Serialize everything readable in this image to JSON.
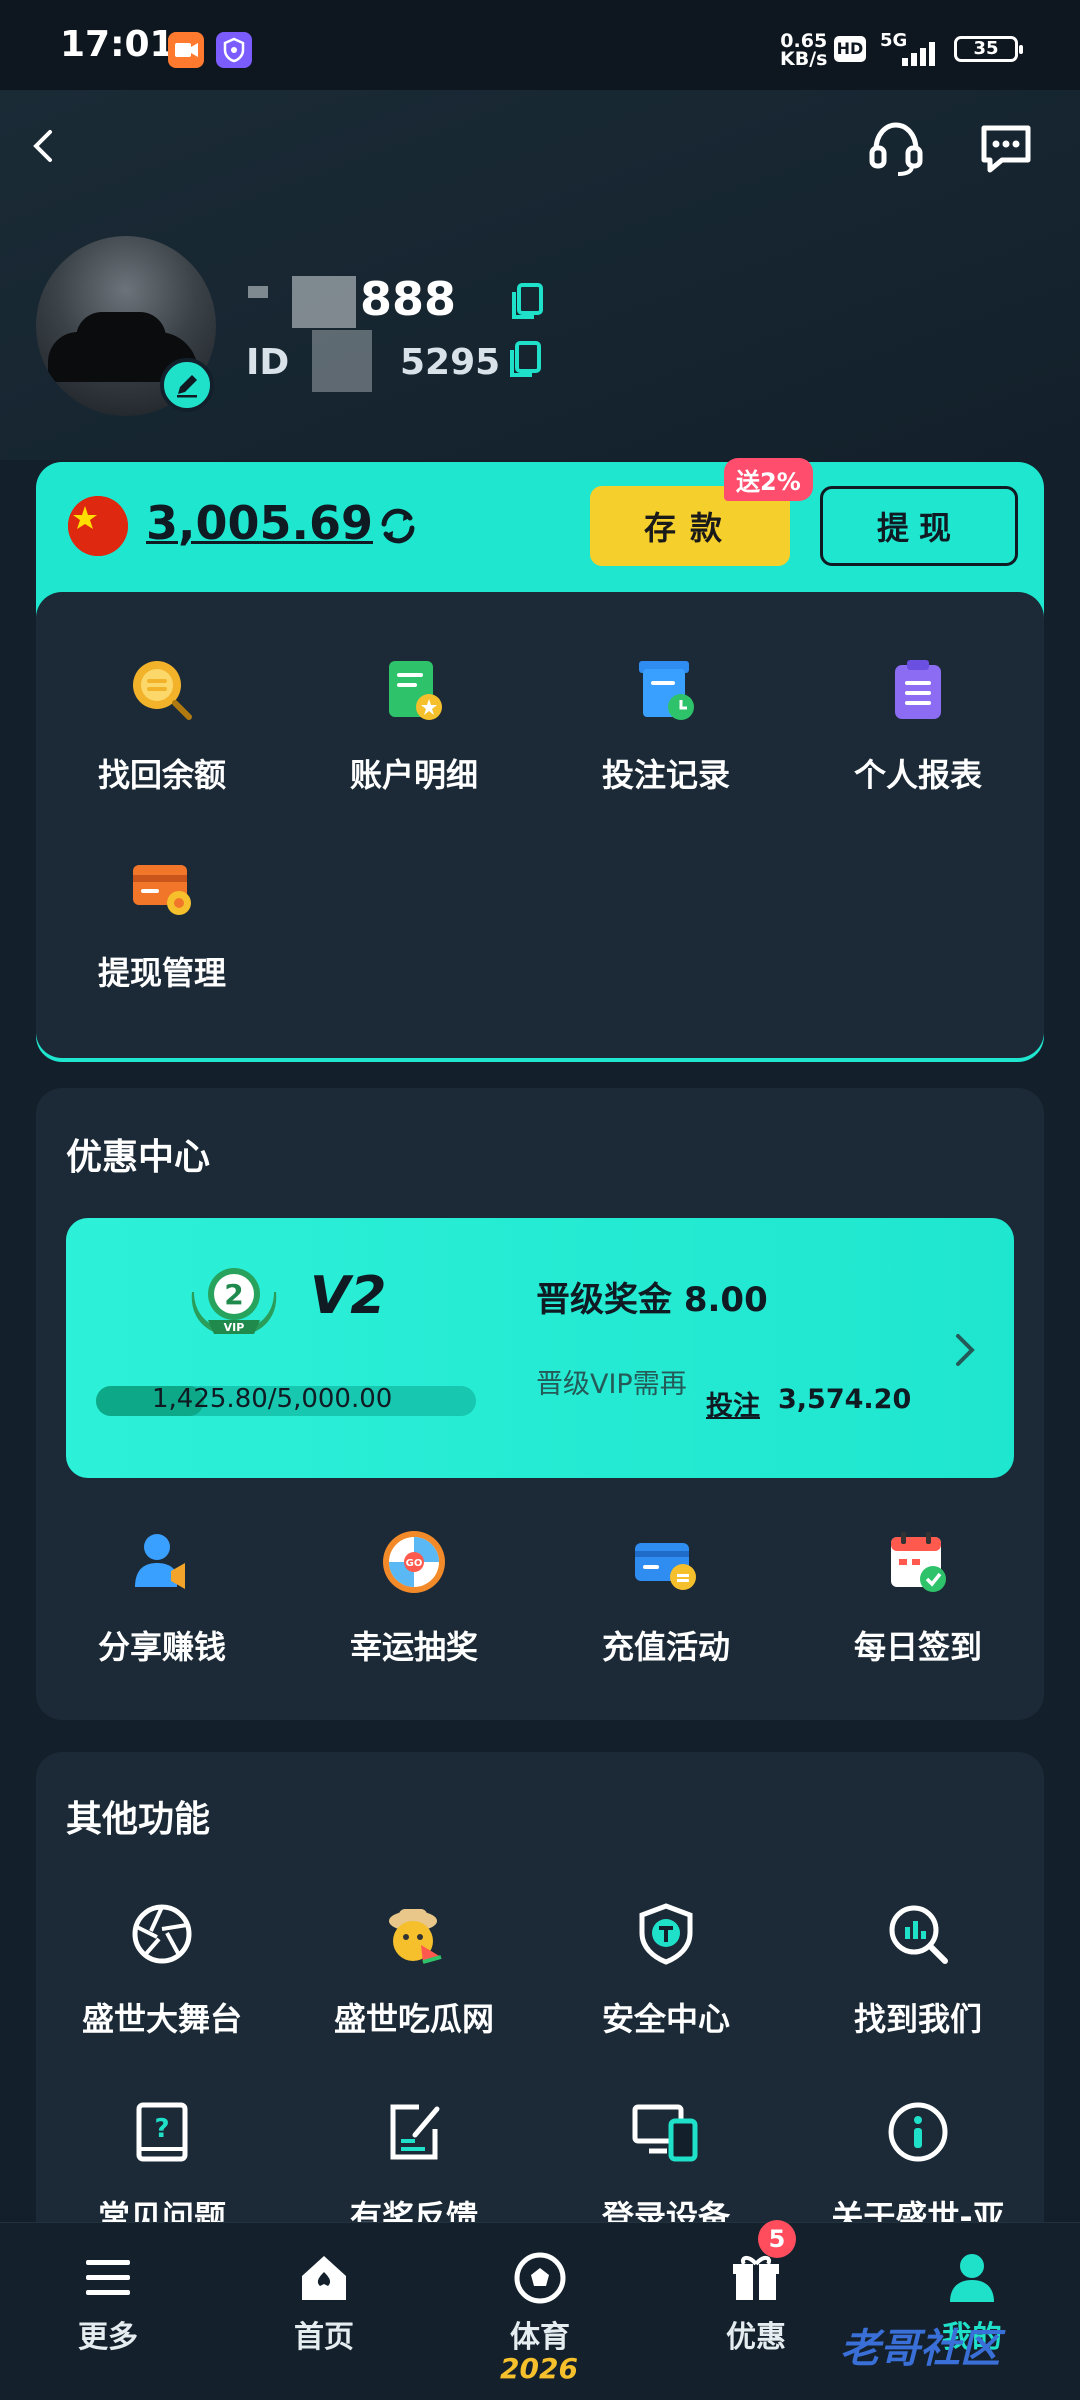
{
  "status_bar": {
    "time": "17:01",
    "net_speed": "0.65",
    "net_unit": "KB/s",
    "hd": "HD",
    "network": "5G",
    "battery": "35"
  },
  "profile": {
    "username_tail": "888",
    "uid_prefix": "ID",
    "uid_tail": "5295"
  },
  "wallet": {
    "balance": "3,005.69",
    "deposit_label": "存款",
    "deposit_tag": "送2%",
    "withdraw_label": "提现",
    "items": [
      {
        "label": "找回余额",
        "icon": "coin-search-icon"
      },
      {
        "label": "账户明细",
        "icon": "ledger-icon"
      },
      {
        "label": "投注记录",
        "icon": "bet-record-icon"
      },
      {
        "label": "个人报表",
        "icon": "clipboard-icon"
      },
      {
        "label": "提现管理",
        "icon": "card-gear-icon"
      }
    ]
  },
  "promo": {
    "title": "优惠中心",
    "vip": {
      "badge_number": "2",
      "badge_text": "VIP",
      "level": "V2",
      "progress_text": "1,425.80/5,000.00",
      "progress_fraction": 0.285,
      "bonus_label": "晋级奖金 8.00",
      "need_label": "晋级VIP需再",
      "bet_link": "投注",
      "bet_amount": "3,574.20"
    },
    "items": [
      {
        "label": "分享赚钱",
        "icon": "share-user-icon"
      },
      {
        "label": "幸运抽奖",
        "icon": "lucky-wheel-icon"
      },
      {
        "label": "充值活动",
        "icon": "recharge-card-icon"
      },
      {
        "label": "每日签到",
        "icon": "calendar-check-icon"
      }
    ]
  },
  "other": {
    "title": "其他功能",
    "items": [
      {
        "label": "盛世大舞台",
        "icon": "aperture-icon"
      },
      {
        "label": "盛世吃瓜网",
        "icon": "melon-face-icon"
      },
      {
        "label": "安全中心",
        "icon": "shield-icon"
      },
      {
        "label": "找到我们",
        "icon": "search-chart-icon"
      },
      {
        "label": "常见问题",
        "icon": "question-book-icon"
      },
      {
        "label": "有奖反馈",
        "icon": "feedback-edit-icon"
      },
      {
        "label": "登录设备",
        "icon": "devices-icon"
      },
      {
        "label": "关于盛世-亚",
        "icon": "info-icon"
      }
    ]
  },
  "bottom_nav": [
    {
      "label": "更多",
      "icon": "menu-icon"
    },
    {
      "label": "首页",
      "icon": "home-icon"
    },
    {
      "label": "体育",
      "icon": "football-icon"
    },
    {
      "label": "优惠",
      "icon": "gift-icon"
    },
    {
      "label": "我的",
      "icon": "user-icon"
    }
  ],
  "nav_badge": "5",
  "decor_year": "2026",
  "watermark": "老哥社区"
}
